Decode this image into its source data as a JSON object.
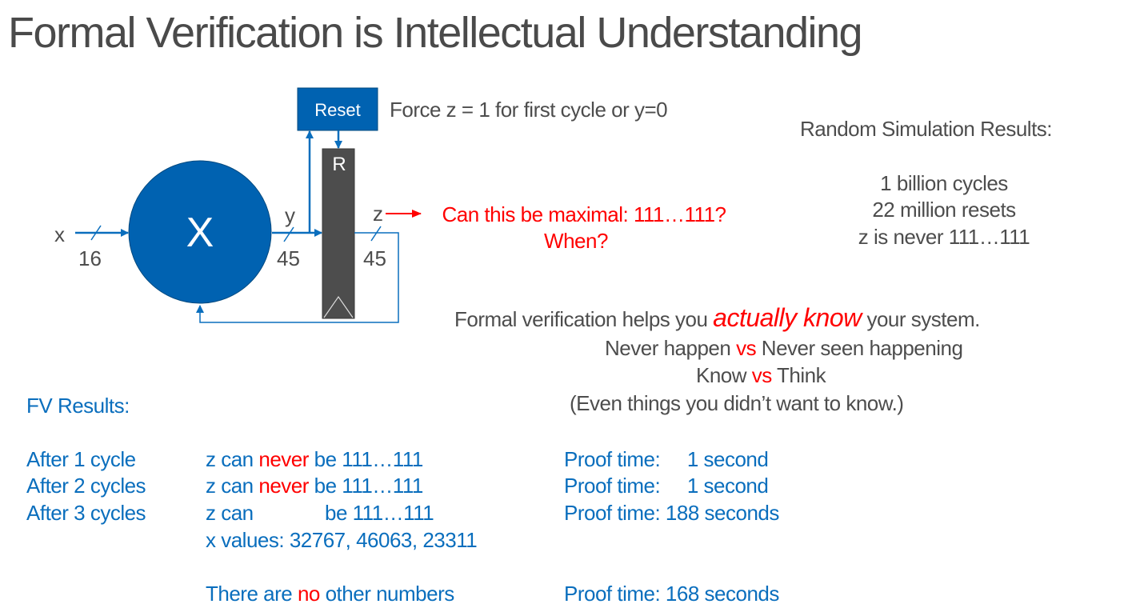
{
  "title": "Formal Verification is Intellectual Understanding",
  "diagram": {
    "reset_block": "Reset",
    "reset_note": "Force z = 1 for first cycle or y=0",
    "register_reset_label": "R",
    "block_x_label": "X",
    "input_signal": "x",
    "input_width": "16",
    "mid_signal": "y",
    "mid_width": "45",
    "output_signal": "z",
    "output_width": "45",
    "question_line1": "Can this be maximal: 111…111?",
    "question_line2": "When?"
  },
  "random_sim": {
    "heading": "Random Simulation Results:",
    "lines": [
      "1 billion cycles",
      "22 million resets",
      "z is never 111…111"
    ]
  },
  "takeaway": {
    "line1_pre": "Formal verification helps you ",
    "line1_emph": "actually know",
    "line1_post": " your system.",
    "line2_a": "Never happen ",
    "line2_vs": "vs",
    "line2_b": " Never seen happening",
    "line3_a": "Know ",
    "line3_vs": "vs",
    "line3_b": " Think",
    "line4": "(Even things you didn’t want to know.)"
  },
  "fv_results": {
    "heading": "FV Results:",
    "rows": [
      {
        "label": "After  1 cycle",
        "pre": "z can ",
        "red": "never",
        "post": " be 111…111",
        "proof": "Proof time:     1 second"
      },
      {
        "label": "After 2 cycles",
        "pre": "z can ",
        "red": "never",
        "post": " be 111…111",
        "proof": "Proof time:     1 second"
      },
      {
        "label": "After 3 cycles",
        "pre": "z can ",
        "red": "",
        "post": "be 111…111",
        "proof": "Proof time: 188 seconds"
      }
    ],
    "x_values": "x values: 32767, 46063, 23311",
    "other_pre": "There are ",
    "other_red": "no",
    "other_post": " other numbers",
    "other_proof": "Proof time: 168 seconds"
  },
  "colors": {
    "blue": "#0a6ebd",
    "block_blue": "#0062b1",
    "register_gray": "#4d4d4d",
    "red": "#ff0000",
    "text_gray": "#4d4d4d"
  }
}
